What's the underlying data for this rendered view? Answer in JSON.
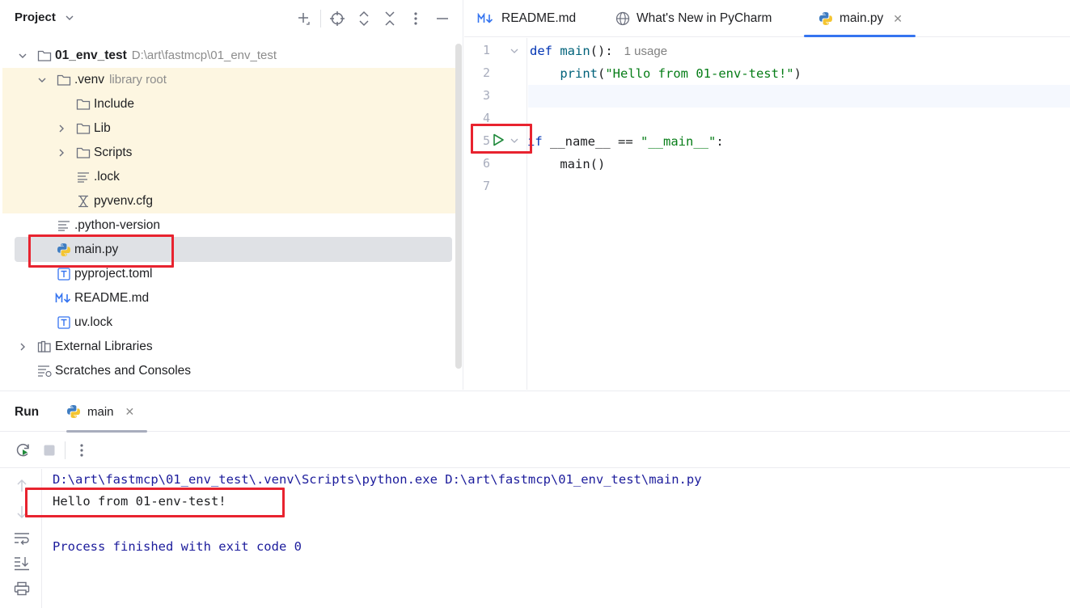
{
  "project": {
    "title": "Project",
    "tree": [
      {
        "label": "01_env_test",
        "path": "D:\\art\\fastmcp\\01_env_test",
        "bold": true
      },
      {
        "label": ".venv",
        "suffix": "library root"
      },
      {
        "label": "Include"
      },
      {
        "label": "Lib"
      },
      {
        "label": "Scripts"
      },
      {
        "label": ".lock"
      },
      {
        "label": "pyvenv.cfg"
      },
      {
        "label": ".python-version"
      },
      {
        "label": "main.py"
      },
      {
        "label": "pyproject.toml"
      },
      {
        "label": "README.md"
      },
      {
        "label": "uv.lock"
      },
      {
        "label": "External Libraries"
      },
      {
        "label": "Scratches and Consoles"
      }
    ]
  },
  "editor": {
    "tabs": [
      {
        "label": "README.md",
        "icon": "markdown-icon"
      },
      {
        "label": "What's New in PyCharm",
        "icon": "globe-icon"
      },
      {
        "label": "main.py",
        "icon": "python-icon",
        "active": true
      }
    ],
    "line_numbers": [
      "1",
      "2",
      "3",
      "4",
      "5",
      "6",
      "7"
    ],
    "code": {
      "l1_kw": "def",
      "l1_fn": "main",
      "l1_rest": "():",
      "l1_hint": "1 usage",
      "l2_indent": "    ",
      "l2_fn": "print",
      "l2_open": "(",
      "l2_str": "\"Hello from 01-env-test!\"",
      "l2_close": ")",
      "l5_kw": "if",
      "l5_name": " __name__ == ",
      "l5_str": "\"__main__\"",
      "l5_colon": ":",
      "l6": "    main()"
    }
  },
  "run": {
    "title": "Run",
    "tab_label": "main",
    "output": {
      "command": "D:\\art\\fastmcp\\01_env_test\\.venv\\Scripts\\python.exe D:\\art\\fastmcp\\01_env_test\\main.py",
      "hello": "Hello from 01-env-test!",
      "finished": "Process finished with exit code 0"
    }
  },
  "colors": {
    "accent": "#3574f0",
    "annotation": "#e8232f",
    "venv_highlight": "#fdf6e1",
    "run_green": "#208a3c"
  }
}
